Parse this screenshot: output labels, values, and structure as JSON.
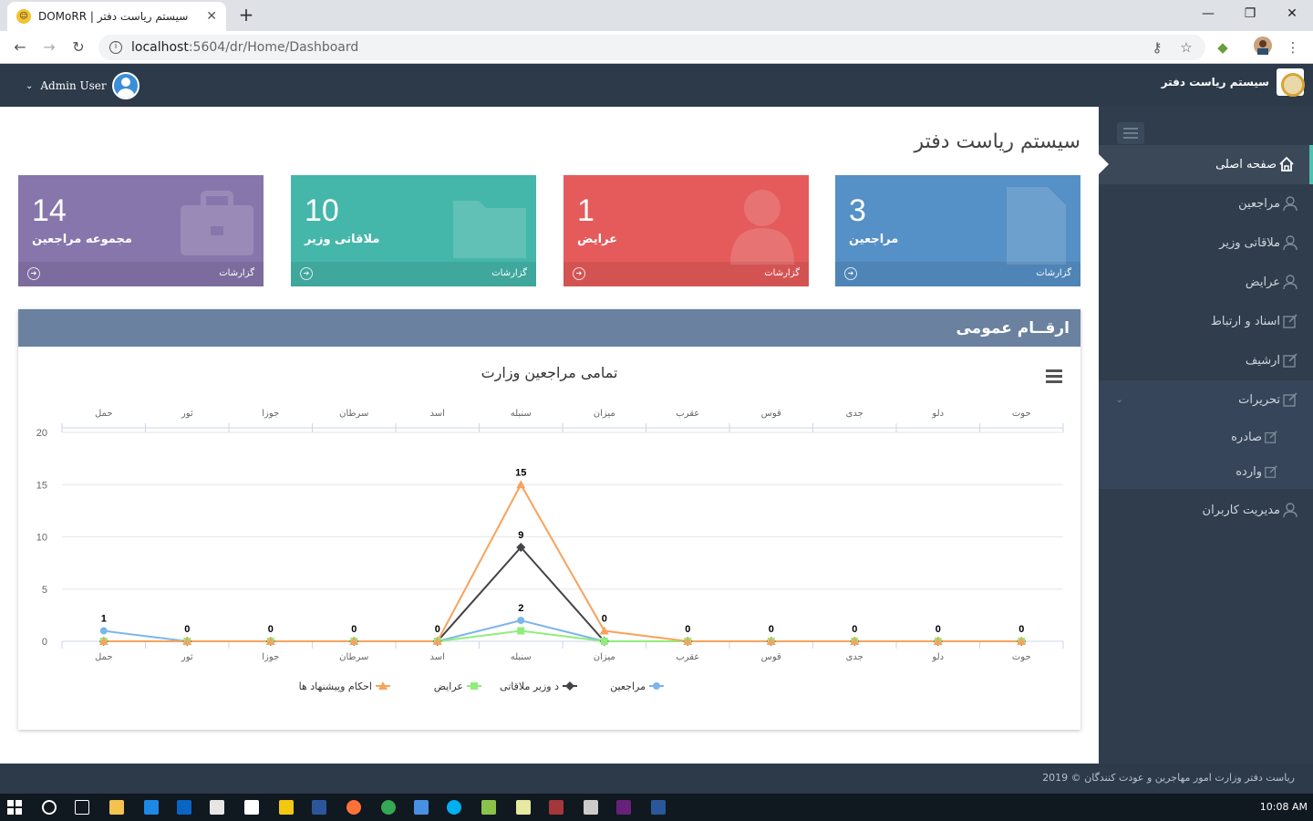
{
  "browser": {
    "tab_title": "DOMoRR | سیستم ریاست دفتر",
    "url_host": "localhost",
    "url_path": ":5604/dr/Home/Dashboard"
  },
  "header": {
    "user_name": "Admin User",
    "brand_name": "سیستم ریاست دفتر"
  },
  "page": {
    "title": "سیستم ریاست دفتر"
  },
  "tiles": [
    {
      "value": "14",
      "label": "مجموعه مراجعین",
      "more": "گزارشات",
      "color": "#8776ac",
      "icon": "briefcase-icon"
    },
    {
      "value": "10",
      "label": "ملاقاتی وزیر",
      "more": "گزارشات",
      "color": "#45b6aa",
      "icon": "folder-icon"
    },
    {
      "value": "1",
      "label": "عرایض",
      "more": "گزارشات",
      "color": "#e55b5b",
      "icon": "user-icon"
    },
    {
      "value": "3",
      "label": "مراجعین",
      "more": "گزارشات",
      "color": "#5590c6",
      "icon": "document-icon"
    }
  ],
  "sidebar": {
    "items": [
      {
        "label": "صفحه اصلی",
        "icon": "home-icon"
      },
      {
        "label": "مراجعین",
        "icon": "user-icon"
      },
      {
        "label": "ملاقاتی وزیر",
        "icon": "user-icon"
      },
      {
        "label": "عرایض",
        "icon": "user-icon"
      },
      {
        "label": "اسناد و ارتباط",
        "icon": "edit-icon"
      },
      {
        "label": "ارشیف",
        "icon": "edit-icon"
      },
      {
        "label": "تحریرات",
        "icon": "edit-icon"
      },
      {
        "label": "مدیریت کاربران",
        "icon": "user-icon"
      }
    ],
    "subitems": [
      {
        "label": "صادره",
        "icon": "edit-icon"
      },
      {
        "label": "وارده",
        "icon": "edit-icon"
      }
    ]
  },
  "panel": {
    "title": "ارقــام عمومی"
  },
  "chart_data": {
    "type": "line",
    "title": "تمامی مراجعین وزارت",
    "categories": [
      "حمل",
      "ثور",
      "جوزا",
      "سرطان",
      "اسد",
      "سنبله",
      "میزان",
      "عقرب",
      "قوس",
      "جدی",
      "دلو",
      "حوت"
    ],
    "ylim": [
      0,
      20
    ],
    "yticks": [
      0,
      5,
      10,
      15,
      20
    ],
    "grid": true,
    "legend_position": "bottom",
    "series": [
      {
        "name": "مراجعین",
        "color": "#7cb5ec",
        "marker": "circle",
        "values": [
          1,
          0,
          0,
          0,
          0,
          2,
          0,
          0,
          0,
          0,
          0,
          0
        ]
      },
      {
        "name": "د وزیر ملاقاتی",
        "color": "#434348",
        "marker": "diamond",
        "values": [
          0,
          0,
          0,
          0,
          0,
          9,
          0,
          0,
          0,
          0,
          0,
          0
        ]
      },
      {
        "name": "عرایض",
        "color": "#90ed7d",
        "marker": "square",
        "values": [
          0,
          0,
          0,
          0,
          0,
          1,
          0,
          0,
          0,
          0,
          0,
          0
        ]
      },
      {
        "name": "احکام وپیشنهاد ها",
        "color": "#f7a35c",
        "marker": "triangle",
        "values": [
          0,
          0,
          0,
          0,
          0,
          15,
          1,
          0,
          0,
          0,
          0,
          0
        ]
      }
    ],
    "data_labels": [
      1,
      0,
      0,
      0,
      0,
      15,
      0,
      0,
      0,
      0,
      0,
      0
    ],
    "extra_labels": [
      {
        "category_index": 5,
        "value": 9
      },
      {
        "category_index": 5,
        "value": 2
      }
    ]
  },
  "footer": {
    "copyright": "2019 © ریاست دفتر وزارت امور مهاجرین و عودت کنندگان"
  },
  "taskbar": {
    "clock": "10:08 AM"
  }
}
